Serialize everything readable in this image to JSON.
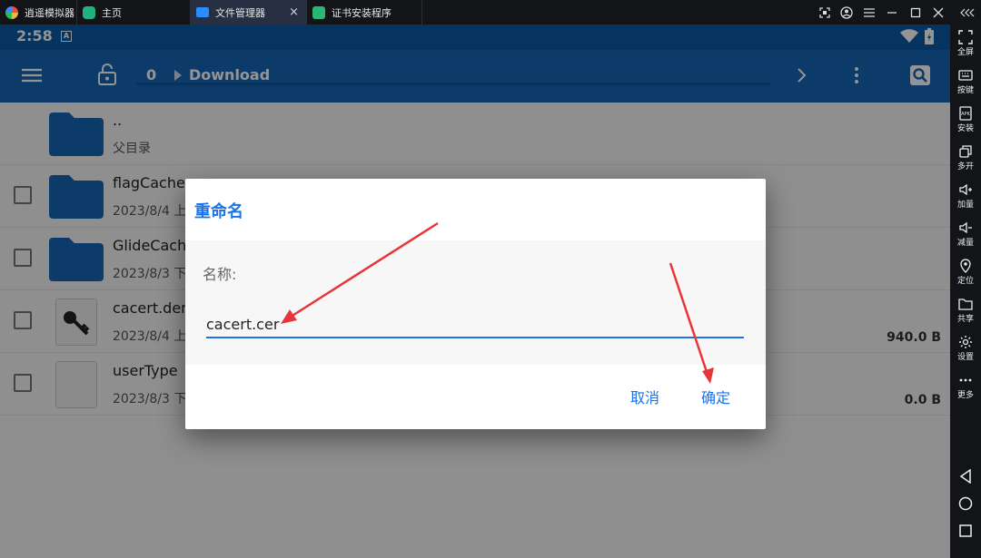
{
  "titlebar": {
    "tabs": [
      {
        "label": "逍遥模拟器",
        "icon": "memu-logo-icon",
        "color": "#f2b233"
      },
      {
        "label": "主页",
        "icon": "home-app-icon",
        "color": "#22b07d"
      },
      {
        "label": "文件管理器",
        "icon": "folder-app-icon",
        "color": "#2b8cff",
        "active": true
      },
      {
        "label": "证书安装程序",
        "icon": "android-app-icon",
        "color": "#2bb673"
      }
    ],
    "close_label": "×"
  },
  "statusbar": {
    "time": "2:58",
    "badge": "A"
  },
  "toolbar": {
    "path_root": "0",
    "path_current": "Download"
  },
  "files": [
    {
      "name": "..",
      "meta": "父目录",
      "type": "folder",
      "size": ""
    },
    {
      "name": "flagCache",
      "meta": "2023/8/4 上",
      "type": "folder",
      "size": ""
    },
    {
      "name": "GlideCach",
      "meta": "2023/8/3 下",
      "type": "folder",
      "size": ""
    },
    {
      "name": "cacert.der",
      "meta": "2023/8/4 上",
      "type": "key",
      "size": "940.0 B"
    },
    {
      "name": "userType",
      "meta": "2023/8/3 下",
      "type": "file",
      "size": "0.0 B"
    }
  ],
  "dialog": {
    "title": "重命名",
    "label": "名称:",
    "input_value": "cacert.cer",
    "cancel": "取消",
    "confirm": "确定"
  },
  "sidebar": {
    "items": [
      {
        "label": "全屏",
        "icon": "fullscreen-icon"
      },
      {
        "label": "按键",
        "icon": "keyboard-icon"
      },
      {
        "label": "安装",
        "icon": "apk-install-icon"
      },
      {
        "label": "多开",
        "icon": "multi-instance-icon"
      },
      {
        "label": "加量",
        "icon": "volume-up-icon"
      },
      {
        "label": "减量",
        "icon": "volume-down-icon"
      },
      {
        "label": "定位",
        "icon": "location-icon"
      },
      {
        "label": "共享",
        "icon": "shared-folder-icon"
      },
      {
        "label": "设置",
        "icon": "gear-icon"
      },
      {
        "label": "更多",
        "icon": "more-icon"
      }
    ]
  },
  "colors": {
    "accent": "#1a73e8",
    "toolbar": "#1766b6",
    "statusbar": "#0c5aa6",
    "annotation": "#e8353a"
  }
}
